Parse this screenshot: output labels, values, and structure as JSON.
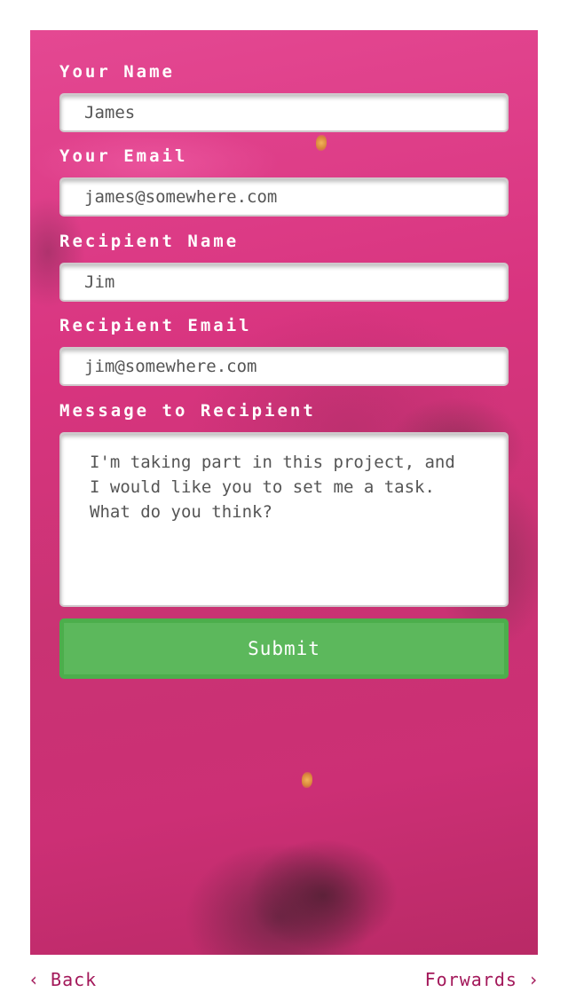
{
  "form": {
    "your_name": {
      "label": "Your Name",
      "value": "James"
    },
    "your_email": {
      "label": "Your Email",
      "value": "james@somewhere.com"
    },
    "recipient_name": {
      "label": "Recipient Name",
      "value": "Jim"
    },
    "recipient_email": {
      "label": "Recipient Email",
      "value": "jim@somewhere.com"
    },
    "message": {
      "label": "Message to Recipient",
      "value": "I'm taking part in this project, and\nI would like you to set me a task.\nWhat do you think?"
    },
    "submit_label": "Submit"
  },
  "nav": {
    "back_label": "Back",
    "forwards_label": "Forwards",
    "back_icon": "chevron-left-icon",
    "forwards_icon": "chevron-right-icon"
  },
  "colors": {
    "panel_pink": "#d8347f",
    "submit_green": "#5cb85c",
    "nav_link": "#a3185a",
    "label_text": "#ffffff"
  }
}
